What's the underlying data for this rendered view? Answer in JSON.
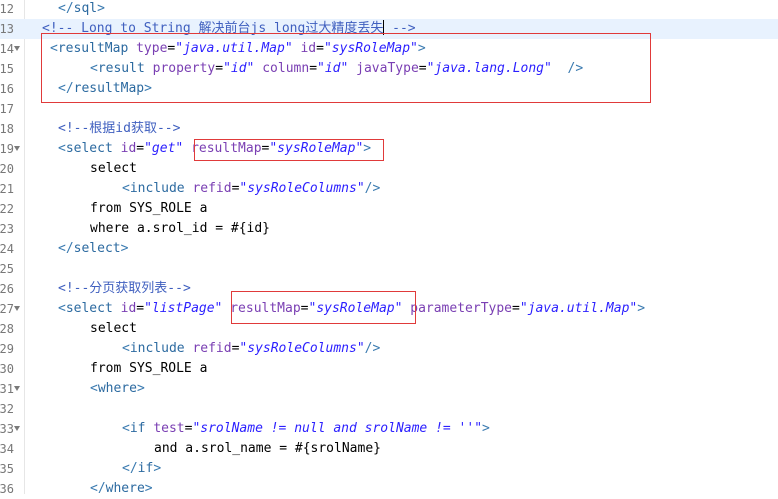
{
  "editor": {
    "lines": [
      {
        "num": "12",
        "fold": false,
        "indent": 58,
        "tokens": [
          {
            "t": "</",
            "c": "tg"
          },
          {
            "t": "sql",
            "c": "tn"
          },
          {
            "t": ">",
            "c": "tg"
          }
        ]
      },
      {
        "num": "13",
        "fold": false,
        "indent": 42,
        "highlight": true,
        "tokens": [
          {
            "t": "<!-- Long to String 解决前台js long过大精度丢失",
            "c": "cm"
          },
          {
            "caret": true
          },
          {
            "t": " -->",
            "c": "cm"
          }
        ]
      },
      {
        "num": "14",
        "fold": true,
        "indent": 50,
        "tokens": [
          {
            "t": "<",
            "c": "tg"
          },
          {
            "t": "resultMap",
            "c": "tn"
          },
          {
            "t": " ",
            "c": "tx"
          },
          {
            "t": "type",
            "c": "at"
          },
          {
            "t": "=",
            "c": "tx"
          },
          {
            "t": "\"java.util.Map\"",
            "c": "ev"
          },
          {
            "t": " ",
            "c": "tx"
          },
          {
            "t": "id",
            "c": "at"
          },
          {
            "t": "=",
            "c": "tx"
          },
          {
            "t": "\"sysRoleMap\"",
            "c": "ev"
          },
          {
            "t": ">",
            "c": "tg"
          }
        ]
      },
      {
        "num": "15",
        "fold": false,
        "indent": 90,
        "tokens": [
          {
            "t": "<",
            "c": "tg"
          },
          {
            "t": "result",
            "c": "tn"
          },
          {
            "t": " ",
            "c": "tx"
          },
          {
            "t": "property",
            "c": "at"
          },
          {
            "t": "=",
            "c": "tx"
          },
          {
            "t": "\"id\"",
            "c": "ev"
          },
          {
            "t": " ",
            "c": "tx"
          },
          {
            "t": "column",
            "c": "at"
          },
          {
            "t": "=",
            "c": "tx"
          },
          {
            "t": "\"id\"",
            "c": "ev"
          },
          {
            "t": " ",
            "c": "tx"
          },
          {
            "t": "javaType",
            "c": "at"
          },
          {
            "t": "=",
            "c": "tx"
          },
          {
            "t": "\"java.lang.Long\"",
            "c": "ev"
          },
          {
            "t": "  />",
            "c": "tg"
          }
        ]
      },
      {
        "num": "16",
        "fold": false,
        "indent": 58,
        "tokens": [
          {
            "t": "</",
            "c": "tg"
          },
          {
            "t": "resultMap",
            "c": "tn"
          },
          {
            "t": ">",
            "c": "tg"
          }
        ]
      },
      {
        "num": "17",
        "fold": false,
        "indent": 58,
        "tokens": []
      },
      {
        "num": "18",
        "fold": false,
        "indent": 58,
        "tokens": [
          {
            "t": "<!--根据id获取-->",
            "c": "cm"
          }
        ]
      },
      {
        "num": "19",
        "fold": true,
        "indent": 58,
        "tokens": [
          {
            "t": "<",
            "c": "tg"
          },
          {
            "t": "select",
            "c": "tn"
          },
          {
            "t": " ",
            "c": "tx"
          },
          {
            "t": "id",
            "c": "at"
          },
          {
            "t": "=",
            "c": "tx"
          },
          {
            "t": "\"get\"",
            "c": "ev"
          },
          {
            "t": " ",
            "c": "tx"
          },
          {
            "t": "resultMap",
            "c": "at"
          },
          {
            "t": "=",
            "c": "tx"
          },
          {
            "t": "\"sysRoleMap\"",
            "c": "ev"
          },
          {
            "t": ">",
            "c": "tg"
          }
        ]
      },
      {
        "num": "20",
        "fold": false,
        "indent": 90,
        "tokens": [
          {
            "t": "select",
            "c": "tx"
          }
        ]
      },
      {
        "num": "21",
        "fold": false,
        "indent": 122,
        "tokens": [
          {
            "t": "<",
            "c": "tg"
          },
          {
            "t": "include",
            "c": "tn"
          },
          {
            "t": " ",
            "c": "tx"
          },
          {
            "t": "refid",
            "c": "at"
          },
          {
            "t": "=",
            "c": "tx"
          },
          {
            "t": "\"sysRoleColumns\"",
            "c": "ev"
          },
          {
            "t": "/>",
            "c": "tg"
          }
        ]
      },
      {
        "num": "22",
        "fold": false,
        "indent": 90,
        "tokens": [
          {
            "t": "from SYS_ROLE a",
            "c": "tx"
          }
        ]
      },
      {
        "num": "23",
        "fold": false,
        "indent": 90,
        "tokens": [
          {
            "t": "where a.srol_id = #{id}",
            "c": "tx"
          }
        ]
      },
      {
        "num": "24",
        "fold": false,
        "indent": 58,
        "tokens": [
          {
            "t": "</",
            "c": "tg"
          },
          {
            "t": "select",
            "c": "tn"
          },
          {
            "t": ">",
            "c": "tg"
          }
        ]
      },
      {
        "num": "25",
        "fold": false,
        "indent": 58,
        "tokens": []
      },
      {
        "num": "26",
        "fold": false,
        "indent": 58,
        "tokens": [
          {
            "t": "<!--分页获取列表-->",
            "c": "cm"
          }
        ]
      },
      {
        "num": "27",
        "fold": true,
        "indent": 58,
        "tokens": [
          {
            "t": "<",
            "c": "tg"
          },
          {
            "t": "select",
            "c": "tn"
          },
          {
            "t": " ",
            "c": "tx"
          },
          {
            "t": "id",
            "c": "at"
          },
          {
            "t": "=",
            "c": "tx"
          },
          {
            "t": "\"listPage\"",
            "c": "ev"
          },
          {
            "t": " ",
            "c": "tx"
          },
          {
            "t": "resultMap",
            "c": "at"
          },
          {
            "t": "=",
            "c": "tx"
          },
          {
            "t": "\"sysRoleMap\"",
            "c": "ev"
          },
          {
            "t": " ",
            "c": "tx"
          },
          {
            "t": "parameterType",
            "c": "at"
          },
          {
            "t": "=",
            "c": "tx"
          },
          {
            "t": "\"java.util.Map\"",
            "c": "ev"
          },
          {
            "t": ">",
            "c": "tg"
          }
        ]
      },
      {
        "num": "28",
        "fold": false,
        "indent": 90,
        "tokens": [
          {
            "t": "select",
            "c": "tx"
          }
        ]
      },
      {
        "num": "29",
        "fold": false,
        "indent": 122,
        "tokens": [
          {
            "t": "<",
            "c": "tg"
          },
          {
            "t": "include",
            "c": "tn"
          },
          {
            "t": " ",
            "c": "tx"
          },
          {
            "t": "refid",
            "c": "at"
          },
          {
            "t": "=",
            "c": "tx"
          },
          {
            "t": "\"sysRoleColumns\"",
            "c": "ev"
          },
          {
            "t": "/>",
            "c": "tg"
          }
        ]
      },
      {
        "num": "30",
        "fold": false,
        "indent": 90,
        "tokens": [
          {
            "t": "from SYS_ROLE a",
            "c": "tx"
          }
        ]
      },
      {
        "num": "31",
        "fold": true,
        "indent": 90,
        "tokens": [
          {
            "t": "<",
            "c": "tg"
          },
          {
            "t": "where",
            "c": "tn"
          },
          {
            "t": ">",
            "c": "tg"
          }
        ]
      },
      {
        "num": "32",
        "fold": false,
        "indent": 90,
        "tokens": []
      },
      {
        "num": "33",
        "fold": true,
        "indent": 122,
        "tokens": [
          {
            "t": "<",
            "c": "tg"
          },
          {
            "t": "if",
            "c": "tn"
          },
          {
            "t": " ",
            "c": "tx"
          },
          {
            "t": "test",
            "c": "at"
          },
          {
            "t": "=",
            "c": "tx"
          },
          {
            "t": "\"srolName != null and srolName != ''\"",
            "c": "ev"
          },
          {
            "t": ">",
            "c": "tg"
          }
        ]
      },
      {
        "num": "34",
        "fold": false,
        "indent": 154,
        "tokens": [
          {
            "t": "and a.srol_name = #{srolName}",
            "c": "tx"
          }
        ]
      },
      {
        "num": "35",
        "fold": false,
        "indent": 122,
        "tokens": [
          {
            "t": "</",
            "c": "tg"
          },
          {
            "t": "if",
            "c": "tn"
          },
          {
            "t": ">",
            "c": "tg"
          }
        ]
      },
      {
        "num": "36",
        "fold": false,
        "indent": 90,
        "tokens": [
          {
            "t": "</",
            "c": "tg"
          },
          {
            "t": "where",
            "c": "tn"
          },
          {
            "t": ">",
            "c": "tg"
          }
        ]
      }
    ]
  },
  "annotations": [
    {
      "name": "resultmap-block-box",
      "colour": "#e03a3a"
    },
    {
      "name": "get-resultmap-box",
      "colour": "#e03a3a"
    },
    {
      "name": "listpage-resultmap-box",
      "colour": "#e03a3a"
    }
  ]
}
